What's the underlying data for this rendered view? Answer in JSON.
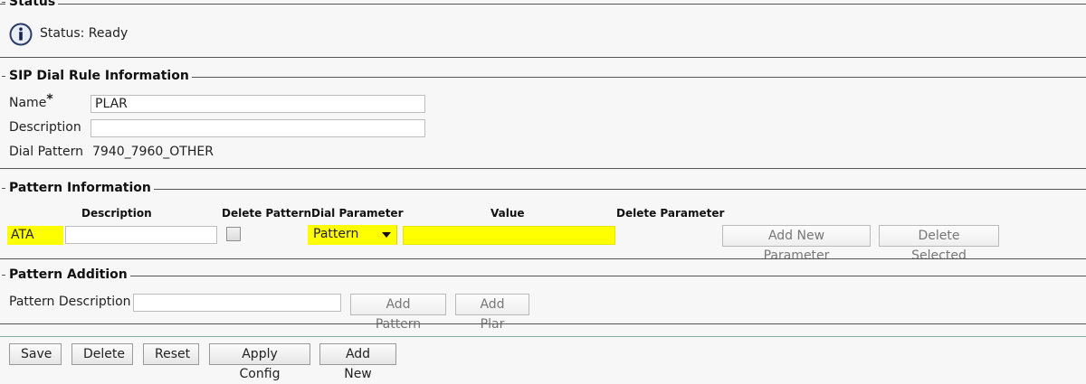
{
  "status": {
    "legend": "Status",
    "text": "Status: Ready",
    "icon": "info-icon"
  },
  "sip": {
    "legend": "SIP Dial Rule Information",
    "name_label": "Name",
    "required_mark": "*",
    "name_value": "PLAR",
    "description_label": "Description",
    "description_value": "",
    "dial_pattern_label": "Dial Pattern",
    "dial_pattern_value": "7940_7960_OTHER"
  },
  "pattern_info": {
    "legend": "Pattern Information",
    "columns": {
      "description": "Description",
      "delete_pattern": "Delete Pattern",
      "dial_parameter": "Dial Parameter",
      "value": "Value",
      "delete_parameter": "Delete Parameter"
    },
    "row": {
      "label": "ATA",
      "description_value": "",
      "delete_pattern_checked": false,
      "dial_parameter_selected": "Pattern",
      "value": ""
    },
    "add_new_parameter": "Add New Parameter",
    "delete_selected": "Delete Selected",
    "highlight_color": "#ffff00"
  },
  "pattern_addition": {
    "legend": "Pattern Addition",
    "pattern_description_label": "Pattern Description",
    "pattern_description_value": "",
    "add_pattern": "Add Pattern",
    "add_plar": "Add Plar"
  },
  "toolbar": {
    "save": "Save",
    "delete": "Delete",
    "reset": "Reset",
    "apply_config": "Apply Config",
    "add_new": "Add New"
  }
}
